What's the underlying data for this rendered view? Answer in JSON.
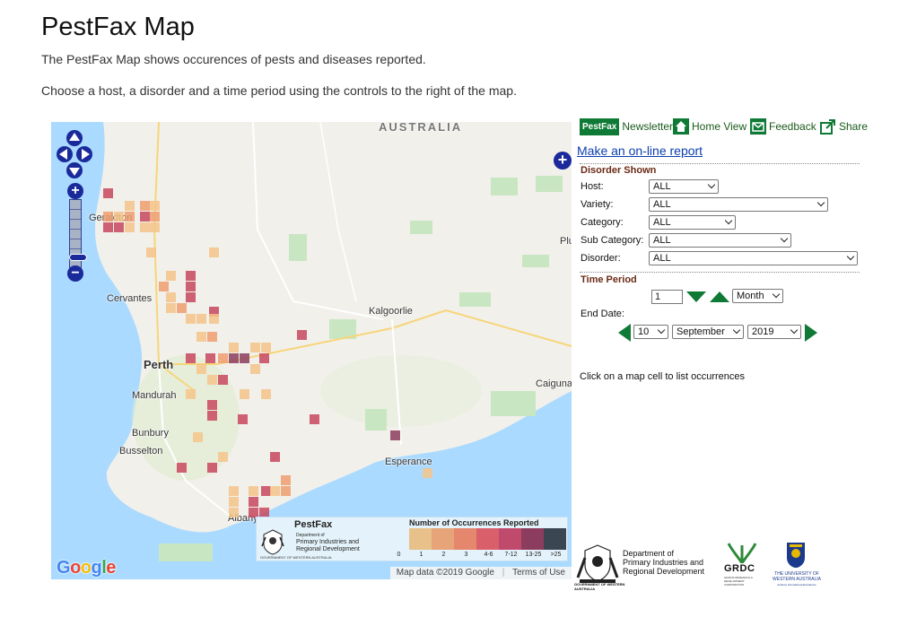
{
  "page": {
    "title": "PestFax Map",
    "intro_1": "The PestFax Map shows occurences of pests and diseases reported.",
    "intro_2": "Choose a host, a disorder and a time period using the controls to the right of the map."
  },
  "map": {
    "labels": {
      "country": "AUSTRALIA",
      "geraldton": "Geraldton",
      "cervantes": "Cervantes",
      "kalgoorlie": "Kalgoorlie",
      "perth": "Perth",
      "mandurah": "Mandurah",
      "bunbury": "Bunbury",
      "busselton": "Busselton",
      "albany": "Albany",
      "esperance": "Esperance",
      "caiguna": "Caiguna",
      "plu": "Plu"
    },
    "google_logo": "Google",
    "attribution": "Map data ©2019 Google",
    "terms": "Terms of Use",
    "legend": {
      "brand": "PestFax",
      "dept_line1": "Department of",
      "dept_line2": "Primary Industries and",
      "dept_line3": "Regional Development",
      "gov_line": "GOVERNMENT OF WESTERN AUSTRALIA",
      "scale_title": "Number of Occurrences Reported",
      "ticks": [
        "0",
        "1",
        "2",
        "3",
        "4-6",
        "7-12",
        "13-25",
        ">25"
      ],
      "colors": [
        "#e8c08a",
        "#e6a478",
        "#e4876c",
        "#d9606a",
        "#c04a6c",
        "#8c3d5e",
        "#3a4652"
      ]
    },
    "cell_colors": {
      "light": "#f5c48a",
      "medium": "#ef9d6e",
      "strong": "#e36c66",
      "deep": "#c8465e",
      "darkest": "#8c3d5e"
    },
    "water_color": "#aadaff"
  },
  "toolbar": {
    "pestfax_badge": "PestFax",
    "newsletter": "Newsletter",
    "home_view": "Home View",
    "feedback": "Feedback",
    "share": "Share"
  },
  "report_link": "Make an on-line report",
  "disorder": {
    "section_title": "Disorder Shown",
    "host_label": "Host:",
    "host_value": "ALL",
    "variety_label": "Variety:",
    "variety_value": "ALL",
    "category_label": "Category:",
    "category_value": "ALL",
    "subcategory_label": "Sub Category:",
    "subcategory_value": "ALL",
    "disorder_label": "Disorder:",
    "disorder_value": "ALL"
  },
  "time": {
    "section_title": "Time Period",
    "period_value": "1",
    "period_unit": "Month",
    "end_date_label": "End Date:",
    "day": "10",
    "month": "September",
    "year": "2019"
  },
  "hint": "Click on a map cell to list occurrences",
  "footer_logos": {
    "dpird_line1": "Department of",
    "dpird_line2": "Primary Industries and",
    "dpird_line3": "Regional Development",
    "gov_line": "GOVERNMENT OF WESTERN AUSTRALIA",
    "grdc": "GRDC",
    "grdc_sub": "GRAINS RESEARCH & DEVELOPMENT CORPORATION",
    "uwa_line1": "THE UNIVERSITY OF",
    "uwa_line2": "WESTERN AUSTRALIA",
    "uwa_tagline": "Achieve International Excellence"
  },
  "colors": {
    "green_brand": "#0f7a35",
    "link_blue": "#0b3fae",
    "section_brown": "#6b2a14",
    "map_control_blue": "#1a2a9a"
  }
}
